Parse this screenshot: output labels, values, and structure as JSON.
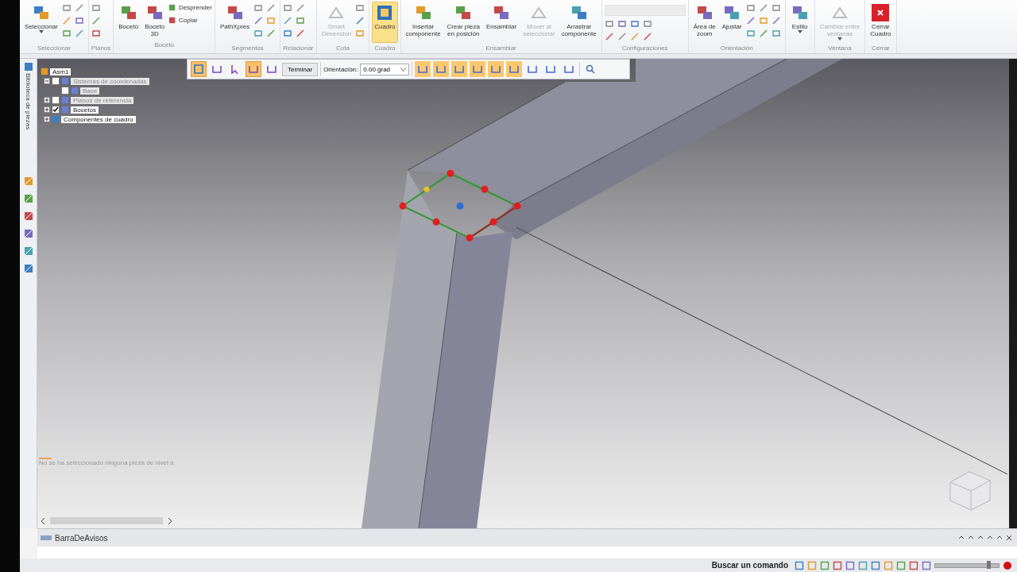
{
  "ribbon": {
    "groups": [
      {
        "label": "Seleccionar",
        "buttons": [
          {
            "kind": "large",
            "label": "Seleccionar",
            "caret": true,
            "disabled": false,
            "selected": false
          }
        ]
      },
      {
        "label": "Planos"
      },
      {
        "label": "Boceto",
        "buttons": [
          {
            "kind": "large",
            "label": "Boceto",
            "disabled": false,
            "selected": false
          },
          {
            "kind": "large",
            "label": "Boceto\n3D",
            "disabled": false,
            "selected": false
          },
          {
            "kind": "small",
            "label": "Desprender",
            "disabled": false,
            "selected": false
          },
          {
            "kind": "small",
            "label": "Copiar",
            "disabled": false,
            "selected": false
          }
        ]
      },
      {
        "label": "Segmentos",
        "buttons": [
          {
            "kind": "large",
            "label": "PathXpres",
            "disabled": false,
            "selected": false
          }
        ]
      },
      {
        "label": "Relacionar"
      },
      {
        "label": "Cota",
        "buttons": [
          {
            "kind": "large",
            "label": "Smart\nDimension",
            "disabled": true,
            "selected": false
          }
        ]
      },
      {
        "label": "Cuadro",
        "buttons": [
          {
            "kind": "large",
            "label": "Cuadro",
            "disabled": false,
            "selected": true
          }
        ]
      },
      {
        "label": "Ensamblar",
        "buttons": [
          {
            "kind": "large",
            "label": "Insertar\ncomponente",
            "disabled": false,
            "selected": false
          },
          {
            "kind": "large",
            "label": "Crear pieza\nen posición",
            "disabled": false,
            "selected": false
          },
          {
            "kind": "large",
            "label": "Ensamblar",
            "disabled": false,
            "selected": false
          },
          {
            "kind": "large",
            "label": "Mover al\nseleccionar",
            "disabled": true,
            "selected": false
          },
          {
            "kind": "large",
            "label": "Arrastrar\ncomponente",
            "disabled": false,
            "selected": false
          }
        ]
      },
      {
        "label": "Configuraciones"
      },
      {
        "label": "Orientación",
        "buttons": [
          {
            "kind": "large",
            "label": "Área de\nzoom",
            "disabled": false,
            "selected": false
          },
          {
            "kind": "large",
            "label": "Ajustar",
            "disabled": false,
            "selected": false
          }
        ]
      },
      {
        "buttons": [
          {
            "kind": "large",
            "label": "Estilo",
            "caret": true,
            "disabled": false,
            "selected": false
          }
        ]
      },
      {
        "label": "Ventana",
        "buttons": [
          {
            "kind": "large",
            "label": "Cambiar entre\nventanas",
            "caret": true,
            "disabled": true,
            "selected": false
          }
        ]
      },
      {
        "label": "Cerrar",
        "buttons": [
          {
            "kind": "large",
            "label": "Cerrar\nCuadro",
            "disabled": false,
            "selected": false
          }
        ]
      }
    ]
  },
  "side_panel": {
    "title": "Biblioteca de piezas"
  },
  "tree": {
    "label": "Asm1",
    "children": [
      {
        "label": "Sistemas de coordenadas",
        "kind": "checkbox",
        "checked": false,
        "expanded": true,
        "dimmed": true,
        "children": [
          {
            "label": "Base",
            "kind": "checkbox",
            "checked": false,
            "dimmed": true
          }
        ]
      },
      {
        "label": "Planos de referencia",
        "kind": "checkbox",
        "checked": false,
        "expanded": false,
        "dimmed": true
      },
      {
        "label": "Bocetos",
        "kind": "checkbox",
        "checked": true,
        "expanded": false,
        "dimmed": false
      },
      {
        "label": "Componentes de cuadro",
        "kind": "plain",
        "expanded": false,
        "dimmed": false
      }
    ]
  },
  "command_bar": {
    "tools": [
      {
        "selected": true
      },
      {
        "selected": false
      },
      {
        "selected": false
      },
      {
        "selected": true
      },
      {
        "selected": false
      }
    ],
    "finish_button": "Terminar",
    "orientation_label": "Orientación:",
    "orientation_value": "0.00 grad",
    "options": [
      {
        "selected": true
      },
      {
        "selected": true
      },
      {
        "selected": true
      },
      {
        "selected": true
      },
      {
        "selected": true
      },
      {
        "selected": true
      },
      {
        "selected": false
      },
      {
        "selected": false
      },
      {
        "selected": false
      }
    ]
  },
  "viewport": {
    "message": "No se ha seleccionado ninguna pieza de nivel a"
  },
  "notice_bar": {
    "title": "BarraDeAvisos"
  },
  "status_bar": {
    "search_label": "Buscar un comando",
    "zoom": {
      "level": 0.85
    }
  }
}
